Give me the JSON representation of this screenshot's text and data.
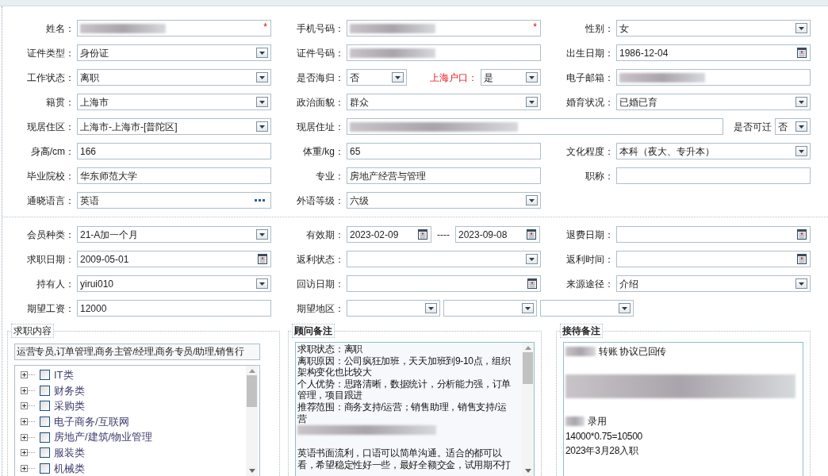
{
  "sections": [
    {
      "rows": [
        [
          {
            "label": "姓名：",
            "fields": [
              {
                "kind": "text",
                "redacted": true,
                "required_mark": "*"
              }
            ]
          },
          {
            "label": "手机号码：",
            "fields": [
              {
                "kind": "text",
                "redacted": true,
                "required_mark": "*"
              }
            ]
          },
          {
            "label": "性别：",
            "fields": [
              {
                "kind": "select",
                "value": "女"
              }
            ]
          }
        ],
        [
          {
            "label": "证件类型：",
            "fields": [
              {
                "kind": "select",
                "value": "身份证"
              }
            ]
          },
          {
            "label": "证件号码：",
            "fields": [
              {
                "kind": "text",
                "redacted": true
              }
            ]
          },
          {
            "label": "出生日期：",
            "fields": [
              {
                "kind": "date",
                "value": "1986-12-04"
              }
            ]
          }
        ],
        [
          {
            "label": "工作状态：",
            "fields": [
              {
                "kind": "select",
                "value": "离职"
              }
            ]
          },
          {
            "label": "是否海归：",
            "fields": [
              {
                "kind": "select",
                "value": "否"
              }
            ],
            "extra": {
              "label": "上海户口：",
              "highlight": true,
              "field": {
                "kind": "select",
                "value": "是"
              }
            }
          },
          {
            "label": "电子邮箱：",
            "fields": [
              {
                "kind": "text",
                "redacted": true
              }
            ]
          }
        ],
        [
          {
            "label": "籍贯：",
            "fields": [
              {
                "kind": "select",
                "value": "上海市"
              }
            ]
          },
          {
            "label": "政治面貌：",
            "fields": [
              {
                "kind": "select",
                "value": "群众"
              }
            ]
          },
          {
            "label": "婚育状况：",
            "fields": [
              {
                "kind": "select",
                "value": "已婚已育"
              }
            ]
          }
        ],
        [
          {
            "label": "现居住区：",
            "fields": [
              {
                "kind": "select",
                "value": "上海市-上海市-[普陀区]"
              }
            ]
          },
          {
            "kind": "wide",
            "label": "现居住址：",
            "fields": [
              {
                "kind": "text",
                "redacted": true
              }
            ],
            "extra": {
              "label": "是否可迁",
              "field": {
                "kind": "select",
                "value": "否"
              }
            }
          }
        ],
        [
          {
            "label": "身高/cm：",
            "fields": [
              {
                "kind": "text",
                "value": "166"
              }
            ]
          },
          {
            "label": "体重/kg：",
            "fields": [
              {
                "kind": "text",
                "value": "65"
              }
            ]
          },
          {
            "label": "文化程度：",
            "fields": [
              {
                "kind": "select",
                "value": "本科（夜大、专升本）"
              }
            ]
          }
        ],
        [
          {
            "label": "毕业院校：",
            "fields": [
              {
                "kind": "text",
                "value": "华东师范大学"
              }
            ]
          },
          {
            "label": "专业：",
            "fields": [
              {
                "kind": "text",
                "value": "房地产经营与管理"
              }
            ]
          },
          {
            "label": "职称：",
            "fields": [
              {
                "kind": "text"
              }
            ]
          }
        ],
        [
          {
            "label": "通晓语言：",
            "fields": [
              {
                "kind": "picker",
                "value": "英语"
              }
            ]
          },
          {
            "label": "外语等级：",
            "fields": [
              {
                "kind": "select",
                "value": "六级"
              }
            ]
          }
        ]
      ]
    },
    {
      "rows": [
        [
          {
            "label": "会员种类：",
            "fields": [
              {
                "kind": "select",
                "value": "21-A加一个月"
              }
            ]
          },
          {
            "label": "有效期：",
            "fields": [
              {
                "kind": "date",
                "value": "2023-02-09"
              },
              {
                "kind": "date",
                "value": "2023-09-08"
              }
            ],
            "separator": "----"
          },
          {
            "label": "退费日期：",
            "fields": [
              {
                "kind": "date"
              }
            ]
          }
        ],
        [
          {
            "label": "求职日期：",
            "fields": [
              {
                "kind": "date",
                "value": "2009-05-01"
              }
            ]
          },
          {
            "label": "返利状态：",
            "fields": [
              {
                "kind": "select"
              }
            ]
          },
          {
            "label": "返利时间：",
            "fields": [
              {
                "kind": "date"
              }
            ]
          }
        ],
        [
          {
            "label": "持有人：",
            "fields": [
              {
                "kind": "select",
                "value": "yirui010"
              }
            ]
          },
          {
            "label": "回访日期：",
            "fields": [
              {
                "kind": "date"
              }
            ]
          },
          {
            "label": "来源途径：",
            "fields": [
              {
                "kind": "select",
                "value": "介绍"
              }
            ]
          }
        ],
        [
          {
            "label": "期望工资：",
            "fields": [
              {
                "kind": "text",
                "value": "12000"
              }
            ]
          },
          {
            "kind": "wide",
            "label": "期望地区：",
            "fields": [
              {
                "kind": "select"
              },
              {
                "kind": "select"
              },
              {
                "kind": "select"
              }
            ]
          }
        ]
      ]
    }
  ],
  "job_panel": {
    "title": "求职内容",
    "selection": "运营专员,订单管理,商务主管/经理,商务专员/助理,销售行",
    "categories": [
      {
        "label": "IT类",
        "checked": false,
        "expanded": false
      },
      {
        "label": "财务类",
        "checked": false,
        "expanded": false
      },
      {
        "label": "采购类",
        "checked": false,
        "expanded": false
      },
      {
        "label": "电子商务/互联网",
        "checked": false,
        "expanded": false
      },
      {
        "label": "房地产/建筑/物业管理",
        "checked": false,
        "expanded": false
      },
      {
        "label": "服装类",
        "checked": false,
        "expanded": false
      },
      {
        "label": "机械类",
        "checked": false,
        "expanded": false
      }
    ]
  },
  "notes_panels": [
    {
      "title": "顾问备注",
      "scrollable": true,
      "lines": [
        {
          "kind": "text",
          "text": "求职状态：离职"
        },
        {
          "kind": "text",
          "text": "离职原因：公司疯狂加班，天天加班到9-10点，组织"
        },
        {
          "kind": "text",
          "text": "架构变化也比较大"
        },
        {
          "kind": "text",
          "text": "个人优势：思路清晰，数据统计，分析能力强，订单"
        },
        {
          "kind": "text",
          "text": "管理，项目跟进"
        },
        {
          "kind": "text",
          "text": "推荐范围：商务支持/运营；销售助理，销售支持/运"
        },
        {
          "kind": "text",
          "text": "营"
        },
        {
          "kind": "redacted"
        },
        {
          "kind": "blank"
        },
        {
          "kind": "text",
          "text": "英语书面流利，口语可以简单沟通。适合的都可以"
        },
        {
          "kind": "text",
          "text": "看，希望稳定性好一些，最好全额交金，试用期不打"
        }
      ]
    },
    {
      "title": "接待备注",
      "scrollable": false,
      "lines": [
        {
          "kind": "redacted-prefix",
          "text": "转账 协议已回传"
        },
        {
          "kind": "blank"
        },
        {
          "kind": "redacted-block"
        },
        {
          "kind": "blank"
        },
        {
          "kind": "redacted-prefix",
          "text": "录用"
        },
        {
          "kind": "small",
          "text": "14000*0.75=10500"
        },
        {
          "kind": "small",
          "text": "2023年3月28入职"
        }
      ]
    }
  ]
}
